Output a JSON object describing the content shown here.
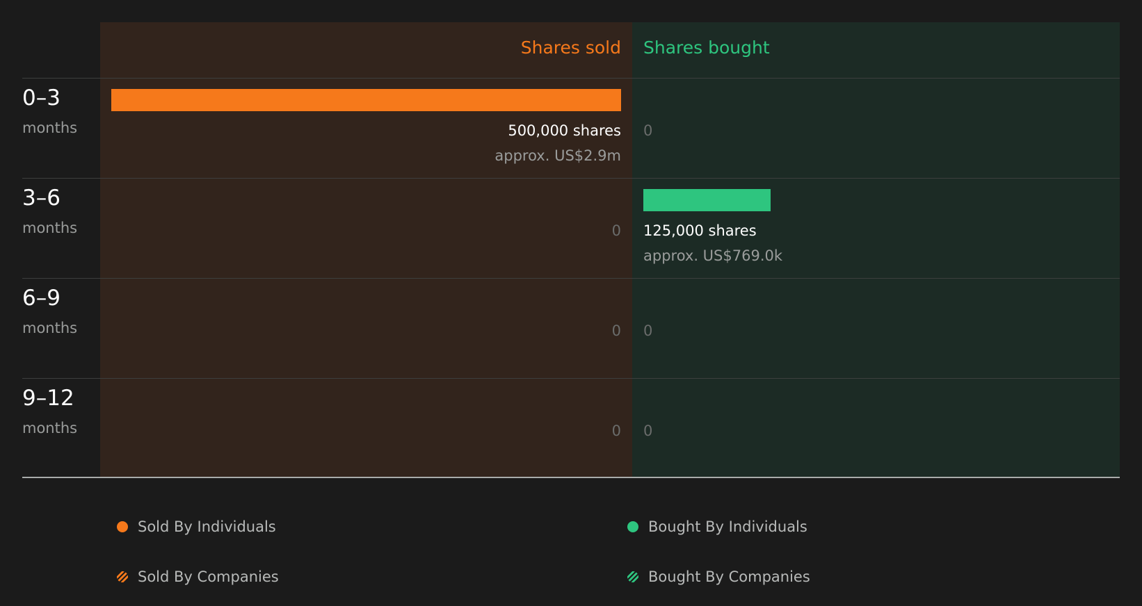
{
  "chart_data": {
    "type": "bar",
    "orientation": "horizontal-diverging",
    "headers": {
      "sold": "Shares sold",
      "bought": "Shares bought"
    },
    "categories": [
      {
        "range": "0–3",
        "unit": "months"
      },
      {
        "range": "3–6",
        "unit": "months"
      },
      {
        "range": "6–9",
        "unit": "months"
      },
      {
        "range": "9–12",
        "unit": "months"
      }
    ],
    "series": [
      {
        "name": "Shares sold",
        "color": "#f6791b",
        "values": [
          500000,
          0,
          0,
          0
        ],
        "labels": [
          {
            "shares": "500,000 shares",
            "approx": "approx. US$2.9m"
          },
          {
            "zero": "0"
          },
          {
            "zero": "0"
          },
          {
            "zero": "0"
          }
        ]
      },
      {
        "name": "Shares bought",
        "color": "#2ec57f",
        "values": [
          0,
          125000,
          0,
          0
        ],
        "labels": [
          {
            "zero": "0"
          },
          {
            "shares": "125,000 shares",
            "approx": "approx. US$769.0k"
          },
          {
            "zero": "0"
          },
          {
            "zero": "0"
          }
        ]
      }
    ],
    "max_value": 500000,
    "legend": {
      "placement": "bottom",
      "items": [
        {
          "label": "Sold By Individuals",
          "color": "#f6791b",
          "style": "solid",
          "icon": "dot-icon"
        },
        {
          "label": "Bought By Individuals",
          "color": "#2ec57f",
          "style": "solid",
          "icon": "dot-icon"
        },
        {
          "label": "Sold By Companies",
          "color": "#f6791b",
          "style": "hatched",
          "icon": "hatched-dot-icon"
        },
        {
          "label": "Bought By Companies",
          "color": "#2ec57f",
          "style": "hatched",
          "icon": "hatched-dot-icon"
        }
      ]
    }
  }
}
